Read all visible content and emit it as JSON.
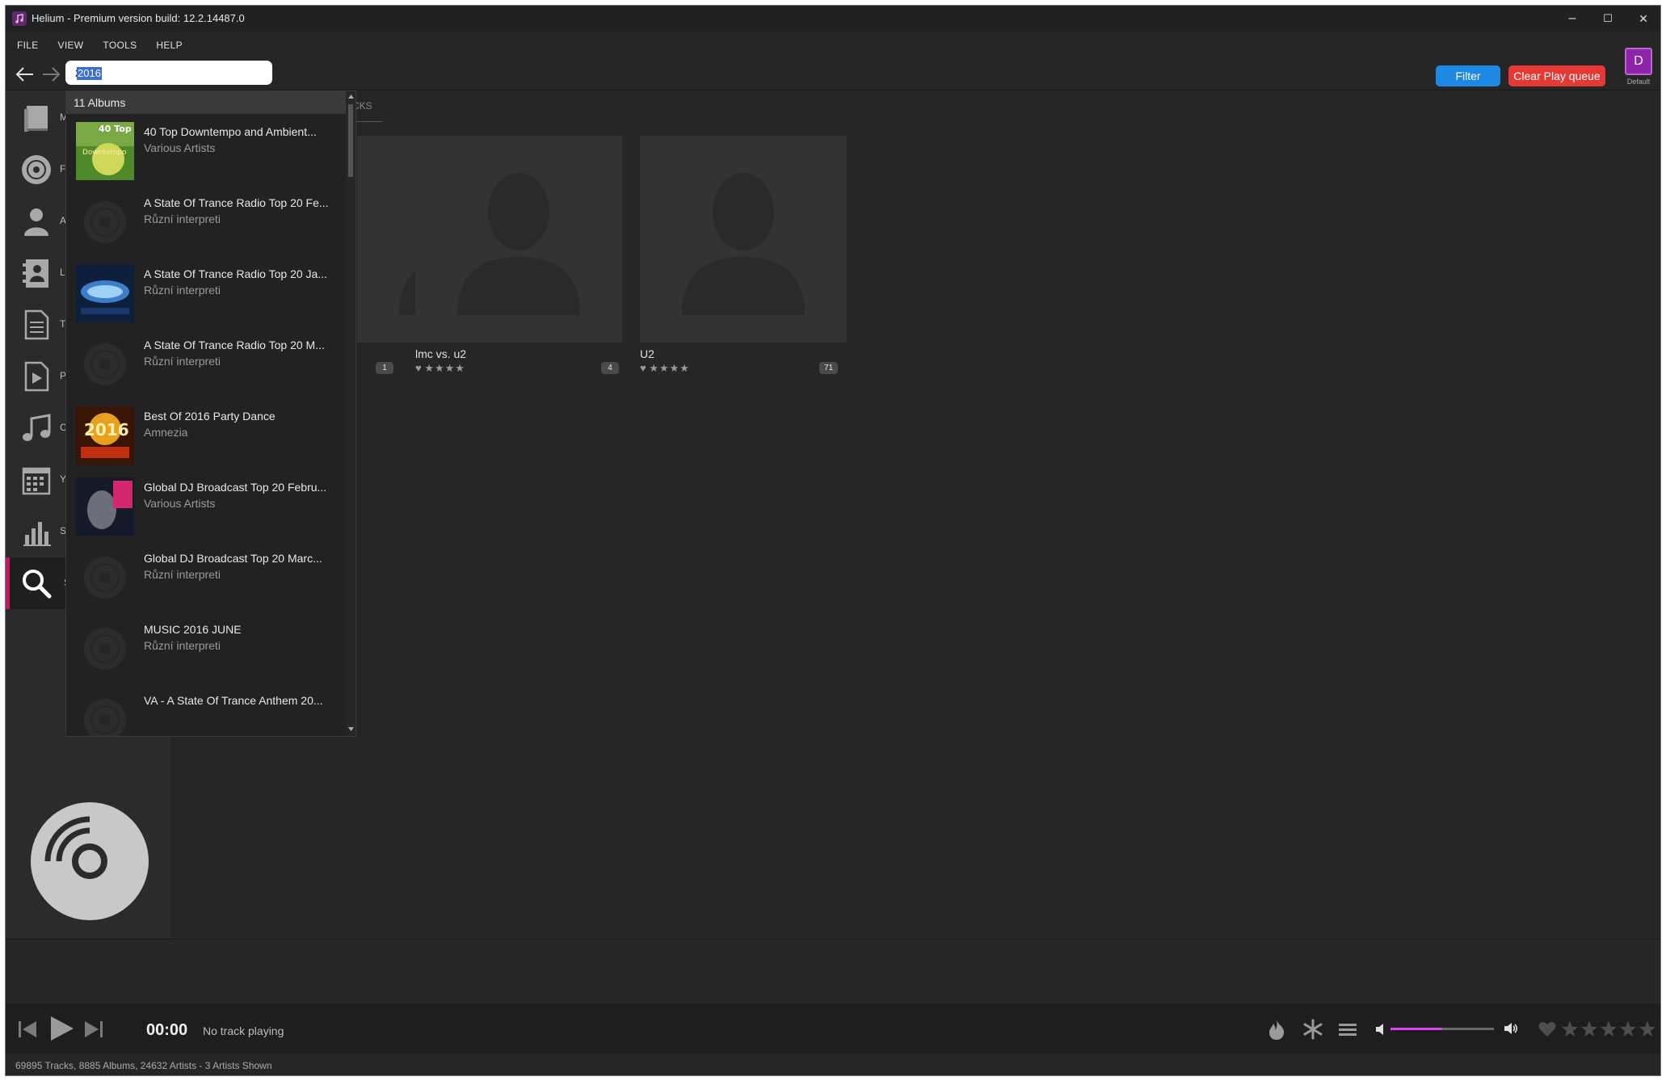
{
  "window": {
    "title": "Helium - Premium version build: 12.2.14487.0",
    "controls": {
      "minimize": "–",
      "maximize": "☐",
      "close": "✕"
    }
  },
  "menu": [
    "FILE",
    "VIEW",
    "TOOLS",
    "HELP"
  ],
  "toolbar": {
    "search_value": "2016",
    "filter_label": "Filter",
    "clear_queue_label": "Clear Play queue",
    "profile_initial": "D",
    "profile_label": "Default"
  },
  "sidebar": {
    "items": [
      {
        "icon": "library-icon",
        "label": "M"
      },
      {
        "icon": "album-disc-icon",
        "label": "F"
      },
      {
        "icon": "artist-icon",
        "label": "A"
      },
      {
        "icon": "contacts-icon",
        "label": "L"
      },
      {
        "icon": "document-icon",
        "label": "T"
      },
      {
        "icon": "playlist-play-icon",
        "label": "P"
      },
      {
        "icon": "music-note-icon",
        "label": "C"
      },
      {
        "icon": "calendar-icon",
        "label": "Y"
      },
      {
        "icon": "statistics-icon",
        "label": "S"
      },
      {
        "icon": "search-icon",
        "label": "S"
      }
    ],
    "active_index": 9
  },
  "content": {
    "tab_label": "CKS",
    "artists": [
      {
        "name": "",
        "count": "1"
      },
      {
        "name": "lmc vs. u2",
        "count": "4"
      },
      {
        "name": "U2",
        "count": "71"
      }
    ]
  },
  "search_dropdown": {
    "header": "11 Albums",
    "results": [
      {
        "title": "40 Top Downtempo and Ambient...",
        "artist": "Various Artists",
        "cover": "green"
      },
      {
        "title": "A State Of Trance Radio Top 20 Fe...",
        "artist": "Různí interpreti",
        "cover": "none"
      },
      {
        "title": "A State Of Trance Radio Top 20 Ja...",
        "artist": "Různí interpreti",
        "cover": "blue"
      },
      {
        "title": "A State Of Trance Radio Top 20 M...",
        "artist": "Různí interpreti",
        "cover": "none"
      },
      {
        "title": "Best Of 2016 Party Dance",
        "artist": "Amnezia",
        "cover": "gold"
      },
      {
        "title": "Global DJ Broadcast Top 20 Febru...",
        "artist": "Various Artists",
        "cover": "dark"
      },
      {
        "title": "Global DJ Broadcast Top 20 Marc...",
        "artist": "Různí interpreti",
        "cover": "none"
      },
      {
        "title": "MUSIC 2016 JUNE",
        "artist": "Různí interpreti",
        "cover": "none"
      },
      {
        "title": "VA - A State Of Trance Anthem 20...",
        "artist": "",
        "cover": "none"
      }
    ]
  },
  "player": {
    "time": "00:00",
    "status": "No track playing",
    "volume": 0.5
  },
  "statusbar": {
    "text": "69895 Tracks, 8885 Albums, 24632 Artists - 3 Artists Shown"
  },
  "colors": {
    "accent": "#c2185b",
    "filter": "#1e88e5",
    "clear": "#e53935",
    "profile": "#8e24aa",
    "volume": "#e040fb"
  }
}
